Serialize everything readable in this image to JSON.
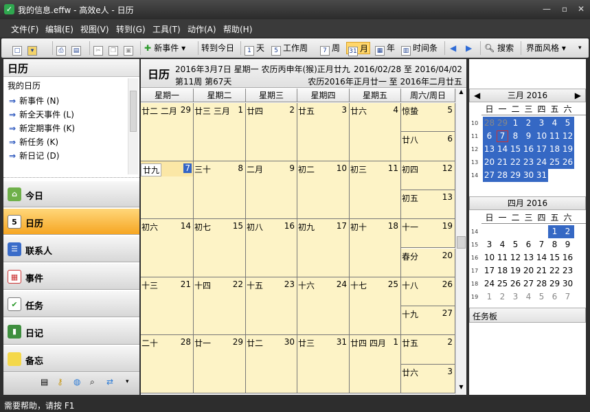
{
  "window": {
    "title": "我的信息.effw - 高效e人 - 日历"
  },
  "menu": [
    "文件(F)",
    "编辑(E)",
    "视图(V)",
    "转到(G)",
    "工具(T)",
    "动作(A)",
    "帮助(H)"
  ],
  "toolbar": {
    "new_event": "新事件",
    "goto_today": "转到今日",
    "day": "天",
    "workweek": "工作周",
    "week": "周",
    "month": "月",
    "year": "年",
    "timeline": "时间条",
    "search": "搜索",
    "ui_style": "界面风格",
    "icons": {
      "day": "1",
      "workweek": "5",
      "week": "7",
      "month": "31",
      "year": "▦",
      "timeline": "▥"
    }
  },
  "left": {
    "title": "日历",
    "my_calendar": "我的日历",
    "links": [
      "新事件 (N)",
      "新全天事件 (L)",
      "新定期事件 (K)",
      "新任务 (K)",
      "新日记 (D)"
    ],
    "nav": [
      {
        "label": "今日",
        "icon": "home-icon"
      },
      {
        "label": "日历",
        "icon": "calendar-icon",
        "active": true
      },
      {
        "label": "联系人",
        "icon": "contacts-icon"
      },
      {
        "label": "事件",
        "icon": "events-icon"
      },
      {
        "label": "任务",
        "icon": "tasks-icon"
      },
      {
        "label": "日记",
        "icon": "diary-icon"
      },
      {
        "label": "备忘",
        "icon": "memo-icon"
      }
    ]
  },
  "center": {
    "title": "日历",
    "date_line": "2016年3月7日 星期一 农历丙申年(猴)正月廿九",
    "week_line": "第11周 第67天",
    "range": "2016/02/28 至 2016/04/02",
    "lunar_range": "农历2016年正月廿一 至 2016年二月廿五",
    "columns": [
      "星期一",
      "星期二",
      "星期三",
      "星期四",
      "星期五",
      "周六/周日"
    ],
    "weeks": [
      {
        "days": [
          [
            "廿二 二月",
            "29"
          ],
          [
            "廿三  三月",
            "1"
          ],
          [
            "廿四",
            "2"
          ],
          [
            "廿五",
            "3"
          ],
          [
            "廿六",
            "4"
          ]
        ],
        "we": [
          [
            "惊蛰",
            "5"
          ],
          [
            "廿八",
            "6"
          ]
        ]
      },
      {
        "days": [
          [
            "廿九",
            "7"
          ],
          [
            "三十",
            "8"
          ],
          [
            "二月",
            "9"
          ],
          [
            "初二",
            "10"
          ],
          [
            "初三",
            "11"
          ]
        ],
        "we": [
          [
            "初四",
            "12"
          ],
          [
            "初五",
            "13"
          ]
        ]
      },
      {
        "days": [
          [
            "初六",
            "14"
          ],
          [
            "初七",
            "15"
          ],
          [
            "初八",
            "16"
          ],
          [
            "初九",
            "17"
          ],
          [
            "初十",
            "18"
          ]
        ],
        "we": [
          [
            "十一",
            "19"
          ],
          [
            "春分",
            "20"
          ]
        ]
      },
      {
        "days": [
          [
            "十三",
            "21"
          ],
          [
            "十四",
            "22"
          ],
          [
            "十五",
            "23"
          ],
          [
            "十六",
            "24"
          ],
          [
            "十七",
            "25"
          ]
        ],
        "we": [
          [
            "十八",
            "26"
          ],
          [
            "十九",
            "27"
          ]
        ]
      },
      {
        "days": [
          [
            "二十",
            "28"
          ],
          [
            "廿一",
            "29"
          ],
          [
            "廿二",
            "30"
          ],
          [
            "廿三",
            "31"
          ],
          [
            "廿四  四月",
            "1"
          ]
        ],
        "we": [
          [
            "廿五",
            "2"
          ],
          [
            "廿六",
            "3"
          ]
        ]
      }
    ]
  },
  "right": {
    "dow": [
      "日",
      "一",
      "二",
      "三",
      "四",
      "五",
      "六"
    ],
    "march": {
      "title": "三月 2016",
      "weeks": [
        "10",
        "11",
        "12",
        "13",
        "14"
      ],
      "rows": [
        [
          "28",
          "29",
          "1",
          "2",
          "3",
          "4",
          "5"
        ],
        [
          "6",
          "7",
          "8",
          "9",
          "10",
          "11",
          "12"
        ],
        [
          "13",
          "14",
          "15",
          "16",
          "17",
          "18",
          "19"
        ],
        [
          "20",
          "21",
          "22",
          "23",
          "24",
          "25",
          "26"
        ],
        [
          "27",
          "28",
          "29",
          "30",
          "31",
          "",
          ""
        ]
      ]
    },
    "april": {
      "title": "四月 2016",
      "weeks": [
        "14",
        "15",
        "16",
        "17",
        "18",
        "19"
      ],
      "rows": [
        [
          "",
          "",
          "",
          "",
          "",
          "1",
          "2"
        ],
        [
          "3",
          "4",
          "5",
          "6",
          "7",
          "8",
          "9"
        ],
        [
          "10",
          "11",
          "12",
          "13",
          "14",
          "15",
          "16"
        ],
        [
          "17",
          "18",
          "19",
          "20",
          "21",
          "22",
          "23"
        ],
        [
          "24",
          "25",
          "26",
          "27",
          "28",
          "29",
          "30"
        ],
        [
          "1",
          "2",
          "3",
          "4",
          "5",
          "6",
          "7"
        ]
      ]
    },
    "taskboard": "任务板"
  },
  "status": "需要帮助，请按 F1"
}
